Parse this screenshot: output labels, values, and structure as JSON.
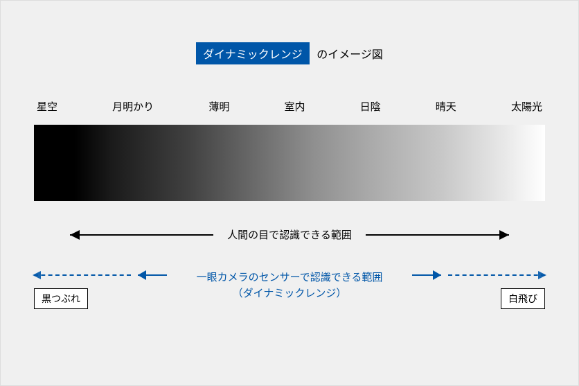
{
  "title": {
    "badge": "ダイナミックレンジ",
    "suffix": "のイメージ図"
  },
  "scale": {
    "labels": [
      "星空",
      "月明かり",
      "薄明",
      "室内",
      "日陰",
      "晴天",
      "太陽光"
    ]
  },
  "ranges": {
    "human": "人間の目で認識できる範囲",
    "camera_line1": "一眼カメラのセンサーで認識できる範囲",
    "camera_line2": "（ダイナミックレンジ）",
    "clipped_dark": "黒つぶれ",
    "clipped_light": "白飛び"
  },
  "colors": {
    "accent": "#0056a8"
  }
}
